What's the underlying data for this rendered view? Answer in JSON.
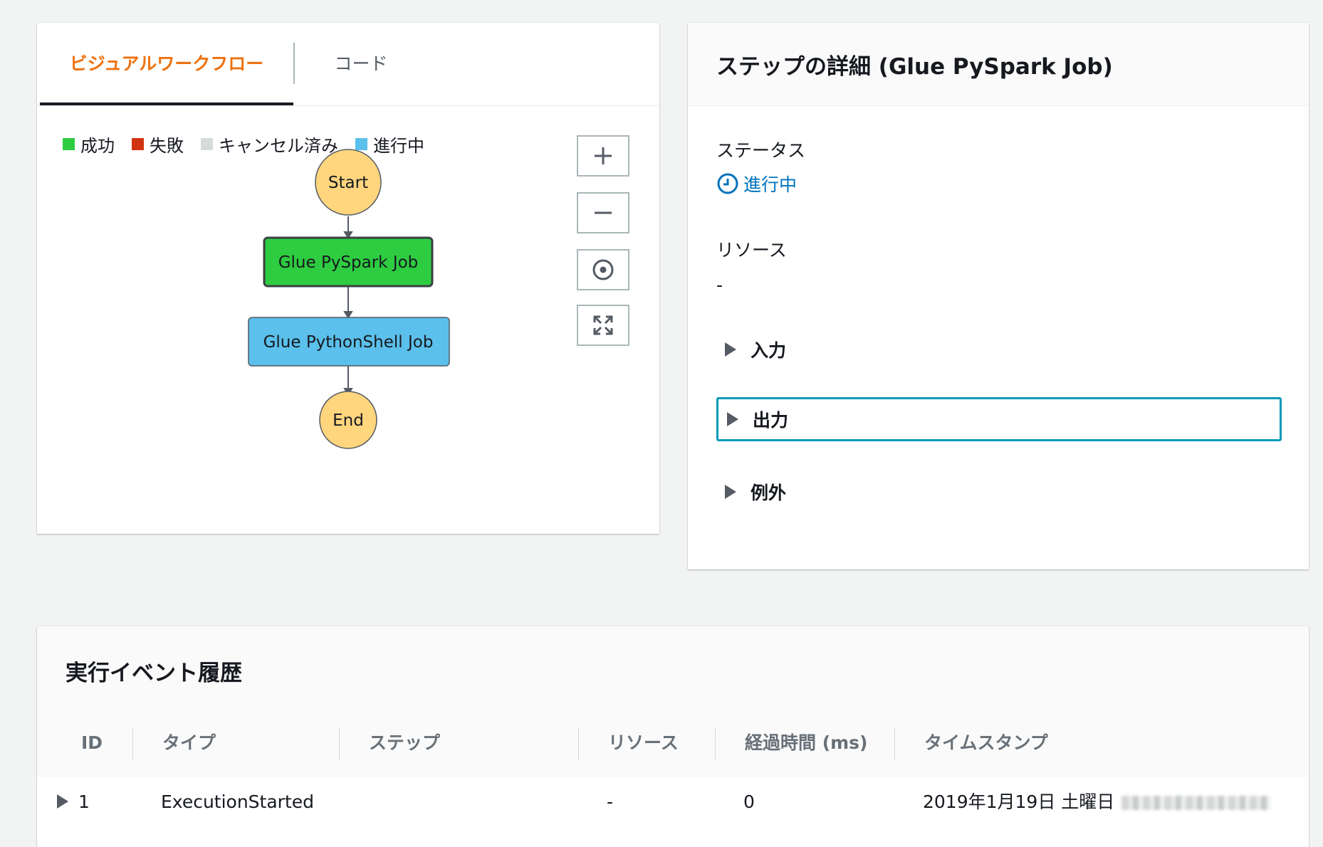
{
  "tabs": {
    "visual": "ビジュアルワークフロー",
    "code": "コード"
  },
  "legend": [
    {
      "label": "成功",
      "color": "#2ecc40"
    },
    {
      "label": "失敗",
      "color": "#d13212"
    },
    {
      "label": "キャンセル済み",
      "color": "#d5dbdb"
    },
    {
      "label": "進行中",
      "color": "#5bc0eb"
    }
  ],
  "workflow": {
    "nodes": {
      "start": "Start",
      "pyspark": "Glue PySpark Job",
      "pythonshell": "Glue PythonShell Job",
      "end": "End"
    },
    "colors": {
      "terminal": "#ffd57e",
      "success": "#2ecc40",
      "in_progress": "#5bc0eb"
    }
  },
  "controls": [
    "zoom-in",
    "zoom-out",
    "center",
    "fit"
  ],
  "detail": {
    "title": "ステップの詳細 (Glue PySpark Job)",
    "status_label": "ステータス",
    "status_value": "進行中",
    "resource_label": "リソース",
    "resource_value": "-",
    "sections": [
      "入力",
      "出力",
      "例外"
    ]
  },
  "history": {
    "title": "実行イベント履歴",
    "columns": [
      "ID",
      "タイプ",
      "ステップ",
      "リソース",
      "経過時間 (ms)",
      "タイムスタンプ"
    ],
    "rows": [
      {
        "id": "1",
        "type": "ExecutionStarted",
        "step": "",
        "resource": "-",
        "elapsed": "0",
        "timestamp": "2019年1月19日 土曜日"
      }
    ]
  }
}
